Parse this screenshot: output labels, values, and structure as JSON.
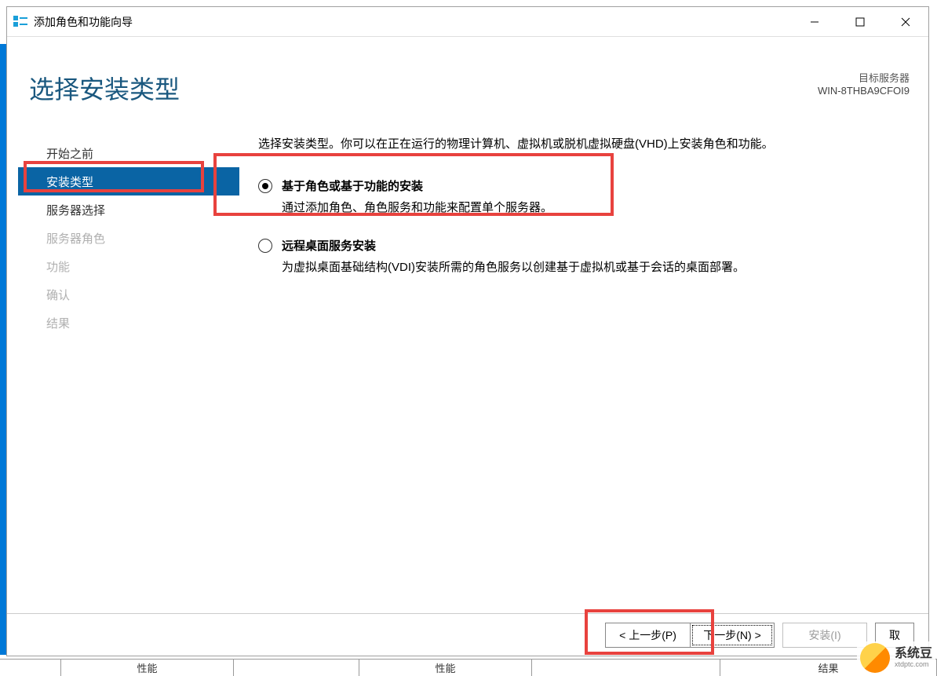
{
  "titlebar": {
    "title": "添加角色和功能向导"
  },
  "header": {
    "page_title": "选择安装类型",
    "target_label": "目标服务器",
    "target_value": "WIN-8THBA9CFOI9"
  },
  "sidebar": {
    "items": [
      {
        "label": "开始之前",
        "state": "normal"
      },
      {
        "label": "安装类型",
        "state": "active"
      },
      {
        "label": "服务器选择",
        "state": "normal"
      },
      {
        "label": "服务器角色",
        "state": "disabled"
      },
      {
        "label": "功能",
        "state": "disabled"
      },
      {
        "label": "确认",
        "state": "disabled"
      },
      {
        "label": "结果",
        "state": "disabled"
      }
    ]
  },
  "main": {
    "instruction": "选择安装类型。你可以在正在运行的物理计算机、虚拟机或脱机虚拟硬盘(VHD)上安装角色和功能。",
    "options": [
      {
        "title": "基于角色或基于功能的安装",
        "desc": "通过添加角色、角色服务和功能来配置单个服务器。",
        "selected": true
      },
      {
        "title": "远程桌面服务安装",
        "desc": "为虚拟桌面基础结构(VDI)安装所需的角色服务以创建基于虚拟机或基于会话的桌面部署。",
        "selected": false
      }
    ]
  },
  "buttons": {
    "prev": "< 上一步(P)",
    "next": "下一步(N) >",
    "install": "安装(I)",
    "cancel": "取"
  },
  "watermark": {
    "text": "系统豆",
    "sub": "xtdptc.com"
  },
  "peek": {
    "c1": "性能",
    "c2": "性能",
    "c3": "结果"
  }
}
